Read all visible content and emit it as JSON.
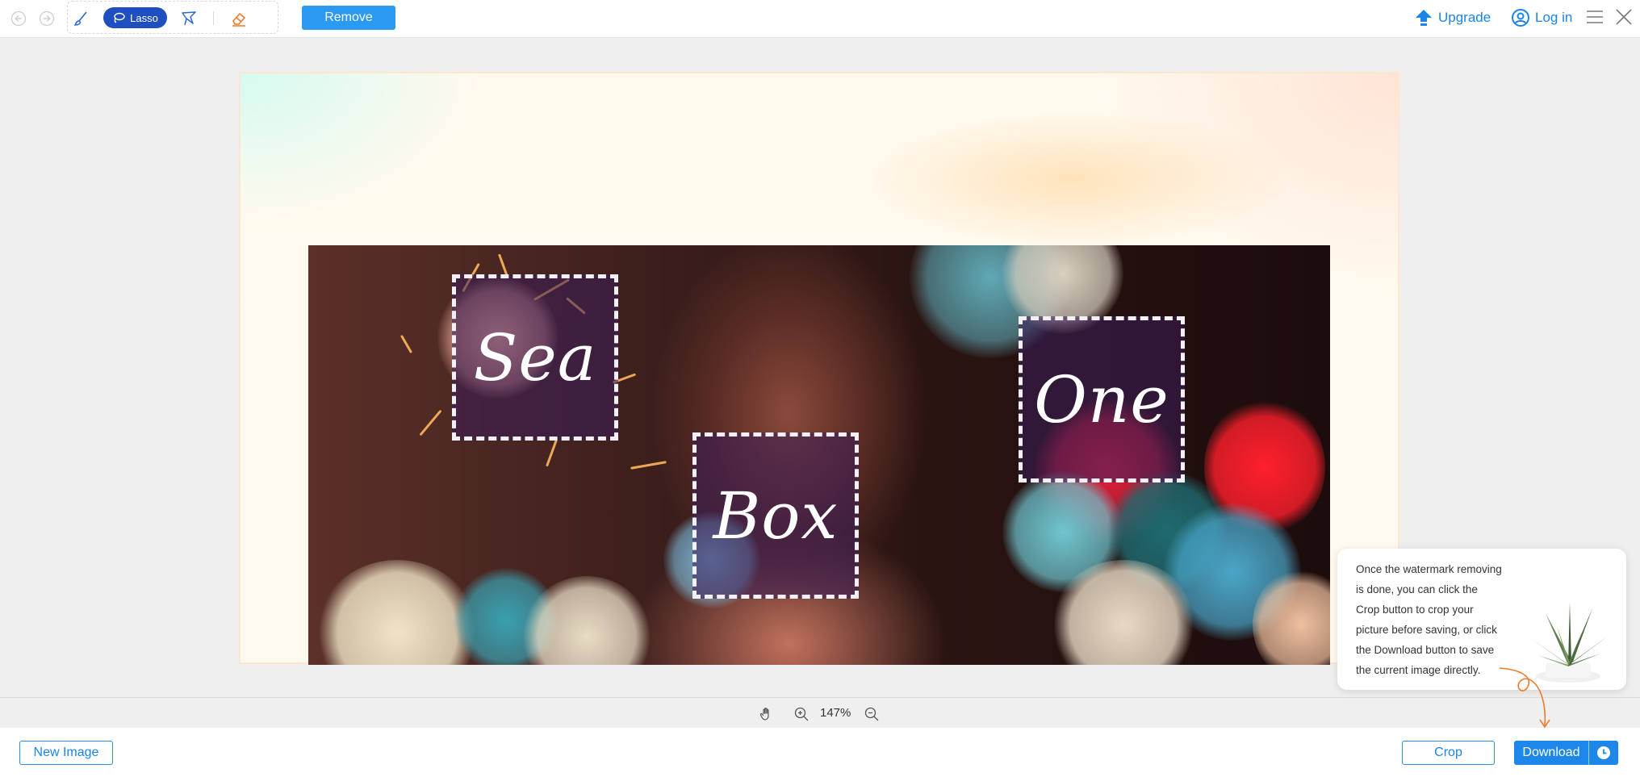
{
  "toolbar": {
    "undo_icon": "undo-icon",
    "redo_icon": "redo-icon",
    "brush_icon": "brush-icon",
    "lasso_label": "Lasso",
    "polygon_icon": "polygonal-lasso-icon",
    "eraser_icon": "eraser-icon",
    "remove_label": "Remove",
    "upgrade_label": "Upgrade",
    "login_label": "Log in",
    "accent_color": "#1b84e9",
    "remove_color": "#2a9af3",
    "lasso_color": "#1f4fc1"
  },
  "image": {
    "watermarks": [
      {
        "text": "Sea"
      },
      {
        "text": "Box"
      },
      {
        "text": "One"
      }
    ]
  },
  "zoom": {
    "level": "147%",
    "hand_icon": "hand-pan-icon",
    "zoom_in_icon": "zoom-in-icon",
    "zoom_out_icon": "zoom-out-icon"
  },
  "bottom": {
    "new_image_label": "New Image",
    "crop_label": "Crop",
    "download_label": "Download",
    "download_icon": "clock-icon"
  },
  "tooltip": {
    "lines": [
      "Once the watermark removing",
      "is done, you can click the",
      "Crop button to crop your",
      "picture before saving, or click",
      "the Download button to save",
      "the current image directly."
    ]
  }
}
